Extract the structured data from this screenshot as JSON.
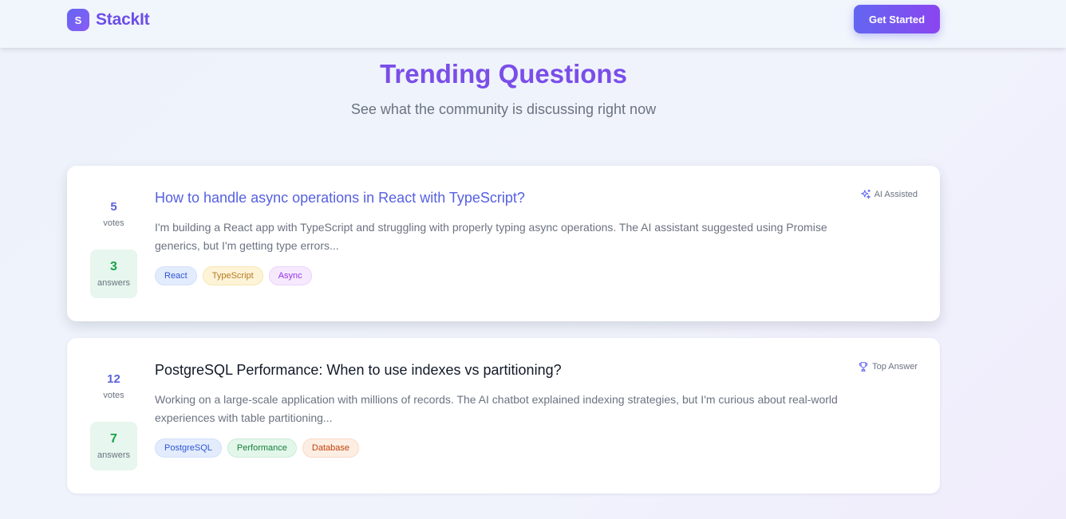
{
  "brand": {
    "logo_letter": "S",
    "name": "StackIt"
  },
  "nav": {
    "cta_label": "Get Started"
  },
  "hero": {
    "title": "Trending Questions",
    "subtitle": "See what the community is discussing right now"
  },
  "questions": [
    {
      "votes": "5",
      "votes_label": "votes",
      "answers": "3",
      "answers_label": "answers",
      "title": "How to handle async operations in React with TypeScript?",
      "excerpt": "I'm building a React app with TypeScript and struggling with properly typing async operations. The AI assistant suggested using Promise generics, but I'm getting type errors...",
      "tags": [
        "React",
        "TypeScript",
        "Async"
      ],
      "badge": {
        "icon": "sparkles-icon",
        "label": "AI Assisted"
      }
    },
    {
      "votes": "12",
      "votes_label": "votes",
      "answers": "7",
      "answers_label": "answers",
      "title": "PostgreSQL Performance: When to use indexes vs partitioning?",
      "excerpt": "Working on a large-scale application with millions of records. The AI chatbot explained indexing strategies, but I'm curious about real-world experiences with table partitioning...",
      "tags": [
        "PostgreSQL",
        "Performance",
        "Database"
      ],
      "badge": {
        "icon": "trophy-icon",
        "label": "Top Answer"
      }
    }
  ],
  "colors": {
    "accent": "#6366f1",
    "brand_purple": "#7a4ee8",
    "answers_green": "#16a34a"
  }
}
